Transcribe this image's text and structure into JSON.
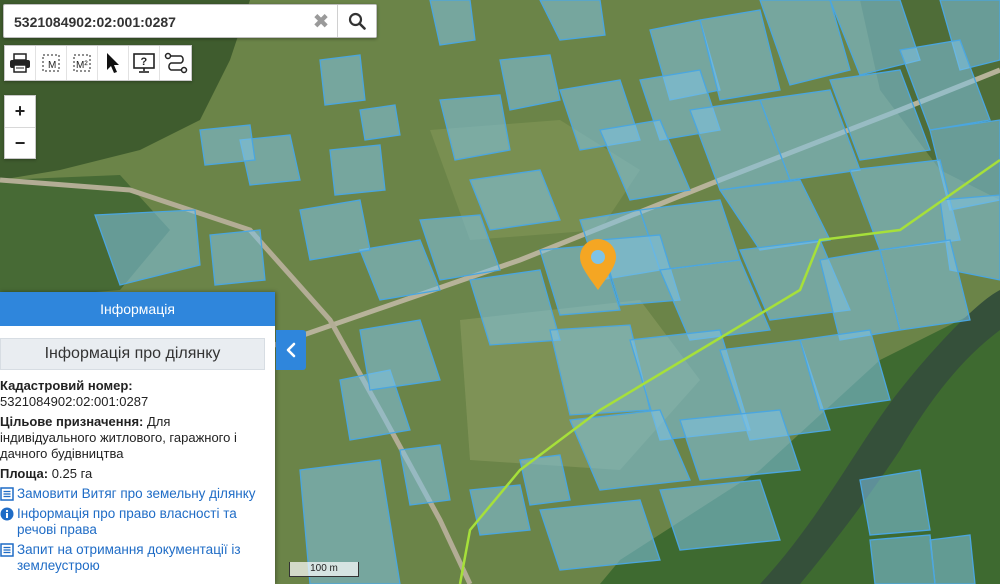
{
  "search": {
    "value": "5321084902:02:001:0287",
    "clear_icon": "close-icon",
    "search_icon": "search-icon"
  },
  "toolbar": {
    "tools": [
      "printer-icon",
      "measure-distance-icon",
      "measure-area-icon",
      "cursor-icon",
      "info-icon",
      "route-icon"
    ],
    "measure_label": "M",
    "area_label": "M²"
  },
  "zoom": {
    "in_label": "+",
    "out_label": "−"
  },
  "panel": {
    "header": "Інформація",
    "subtitle": "Інформація про ділянку",
    "cadastral_label": "Кадастровий номер:",
    "cadastral_value": "5321084902:02:001:0287",
    "purpose_label": "Цільове призначення:",
    "purpose_value": "Для індивідуального житлового, гаражного і дачного будівництва",
    "area_label": "Площа:",
    "area_value": "0.25 га",
    "links": [
      "Замовити Витяг про земельну ділянку",
      "Інформація про право власності та речові права",
      "Запит на отримання документації із землеустрою"
    ]
  },
  "scale_label": "100 m",
  "colors": {
    "parcel_fill": "#7fc3e6",
    "parcel_stroke": "#4aa6e0",
    "marker": "#f5a623",
    "accent": "#2f86dc",
    "boundary_line": "#a6e03a"
  }
}
